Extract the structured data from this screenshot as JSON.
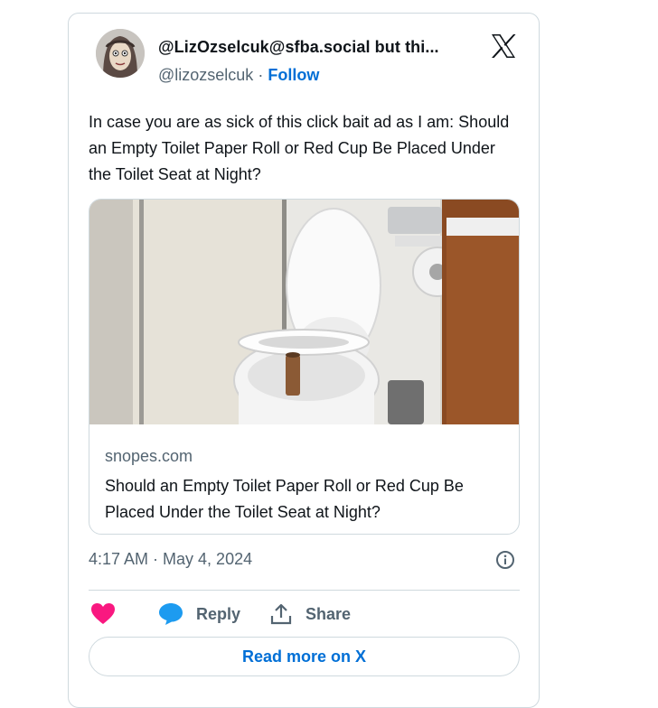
{
  "tweet": {
    "display_name": "@LizOzselcuk@sfba.social but thi...",
    "handle": "@lizozselcuk",
    "separator": "·",
    "follow_label": "Follow",
    "text": "In case you are as sick of this click bait ad as I am: Should an Empty Toilet Paper Roll or Red Cup Be Placed Under the Toilet Seat at Night?",
    "timestamp": "4:17 AM · May 4, 2024"
  },
  "link_card": {
    "domain": "snopes.com",
    "title": "Should an Empty Toilet Paper Roll or Red Cup Be Placed Under the Toilet Seat at Night?"
  },
  "actions": {
    "like_icon": "heart-icon",
    "reply_label": "Reply",
    "share_label": "Share"
  },
  "read_more_label": "Read more on X",
  "colors": {
    "accent": "#006fd6",
    "like": "#f91880",
    "reply_icon": "#1d9bf0",
    "secondary_text": "#536471",
    "border": "#cfd9de"
  }
}
